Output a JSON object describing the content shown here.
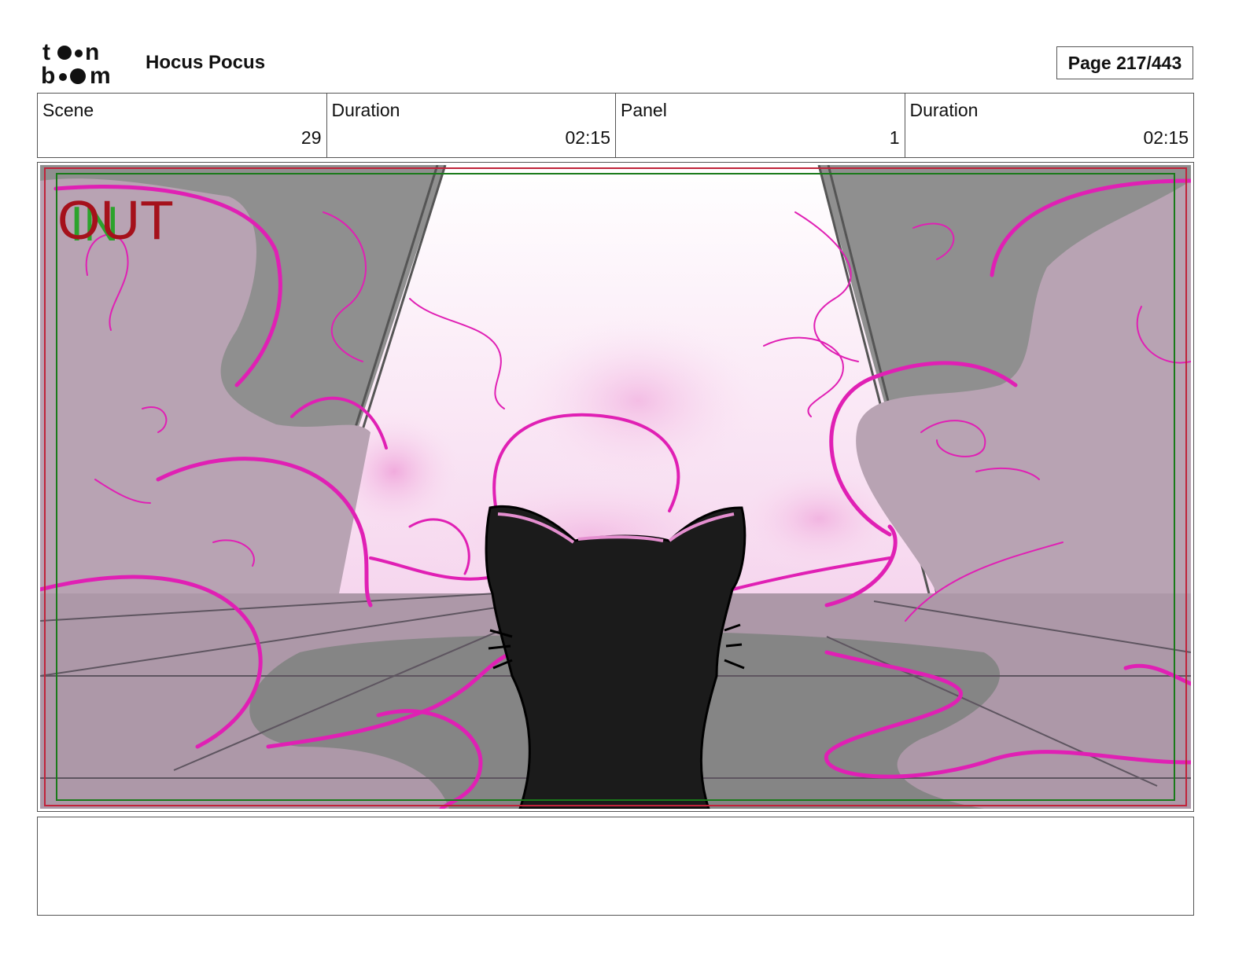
{
  "header": {
    "logo_top": "to•n",
    "logo_bottom": "b••m",
    "project_title": "Hocus Pocus",
    "page_label": "Page 217/443"
  },
  "info": {
    "scene_label": "Scene",
    "scene_value": "29",
    "scene_duration_label": "Duration",
    "scene_duration_value": "02:15",
    "panel_label": "Panel",
    "panel_value": "1",
    "panel_duration_label": "Duration",
    "panel_duration_value": "02:15"
  },
  "panel": {
    "in_marker": "IN",
    "out_marker": "OUT"
  },
  "notes": {
    "text": ""
  },
  "colors": {
    "magic_pink": "#e020b4",
    "wall_gray": "#8f8f8f",
    "smoke_mauve": "#b8a3b3",
    "cat_black": "#1b1b1b",
    "safe_frame_green": "#1a7a1a",
    "action_frame_red": "#c0233a"
  }
}
